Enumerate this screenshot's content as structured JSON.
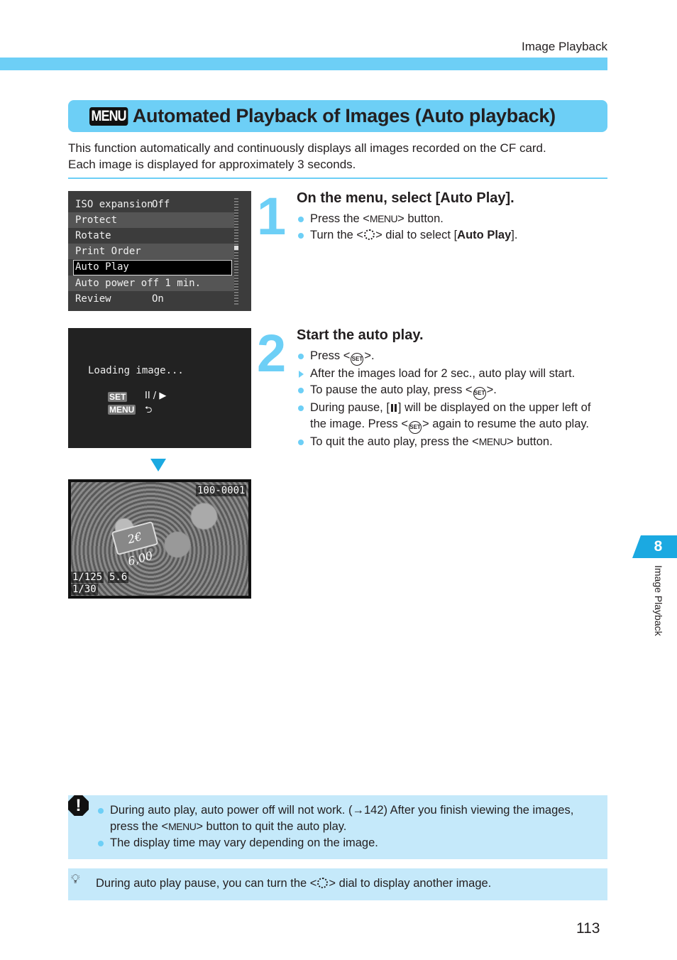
{
  "header": {
    "running_head": "Image Playback"
  },
  "title": {
    "badge": "MENU",
    "text": "Automated Playback of Images (Auto playback)"
  },
  "intro": {
    "line1": "This function automatically and continuously displays all images recorded on the CF card.",
    "line2": "Each image is displayed for approximately 3 seconds."
  },
  "menu_screen": {
    "rows": [
      {
        "label": "ISO expansion",
        "value": "Off"
      },
      {
        "label": "Protect",
        "value": ""
      },
      {
        "label": "Rotate",
        "value": ""
      },
      {
        "label": "Print Order",
        "value": ""
      },
      {
        "label": "Auto Play",
        "value": "",
        "selected": true
      },
      {
        "label": "Auto power off 1 min.",
        "value": ""
      },
      {
        "label": "Review",
        "value": "On"
      }
    ]
  },
  "loading_screen": {
    "text": "Loading image...",
    "set_badge": "SET",
    "set_action": "II / ▶",
    "menu_badge": "MENU",
    "menu_action": "⮌"
  },
  "photo_screen": {
    "file_number": "100-0001",
    "shutter": "1/125",
    "aperture": "5.6",
    "third_line": "1/30",
    "sign_text": "2€ 6,00"
  },
  "steps": [
    {
      "number": "1",
      "title": "On the menu, select [Auto Play].",
      "bullets": [
        {
          "pre": "Press the <",
          "token": "MENU",
          "post": "> button."
        },
        {
          "pre": "Turn the <",
          "token": "dial",
          "post": "> dial to select [",
          "bold": "Auto Play",
          "end": "]."
        }
      ]
    },
    {
      "number": "2",
      "title": "Start the auto play.",
      "bullets": [
        {
          "pre": "Press <",
          "token": "SET",
          "post": ">."
        },
        {
          "pre": "After the images load for 2 sec., auto play will start.",
          "marker": "triangle"
        },
        {
          "pre": "To pause the auto play, press <",
          "token": "SET",
          "post": ">."
        },
        {
          "pre": "During pause, [",
          "token": "pause",
          "post": "] will be displayed on the upper left of the image. Press <",
          "token2": "SET",
          "end": "> again to resume the auto play."
        },
        {
          "pre": "To quit the auto play, press the <",
          "token": "MENU",
          "post": "> button."
        }
      ]
    }
  ],
  "caution": {
    "icon": "caution-icon",
    "items": [
      {
        "pre": "During auto play, auto power off will not work. (→142) After you finish viewing the images, press the <",
        "token": "MENU",
        "post": "> button to quit the auto play."
      },
      {
        "pre": "The display time may vary depending on the image."
      }
    ]
  },
  "tip": {
    "icon": "lightbulb-icon",
    "pre": "During auto play pause, you can turn the <",
    "post": "> dial to display another image."
  },
  "side_tab": {
    "chapter": "8",
    "label": "Image Playback"
  },
  "footer": {
    "page_number": "113"
  },
  "colors": {
    "accent": "#6dcff6",
    "accent_dark": "#1ba9e1",
    "note_bg": "#c5e9fa",
    "text": "#231f20"
  }
}
